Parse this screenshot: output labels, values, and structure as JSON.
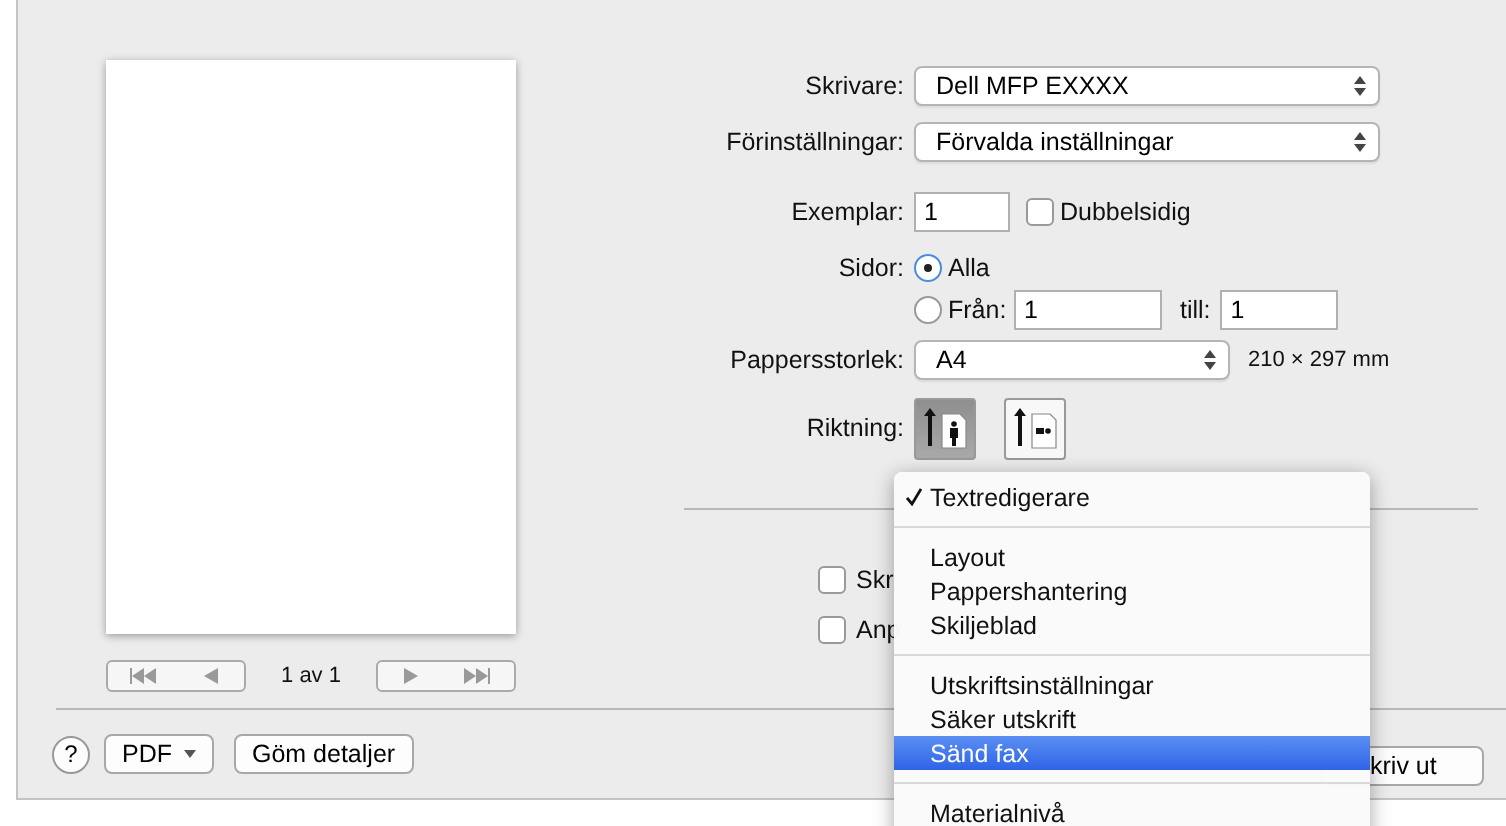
{
  "preview": {
    "page_counter": "1 av 1"
  },
  "printer": {
    "label": "Skrivare:",
    "value": "Dell MFP EXXXX"
  },
  "presets": {
    "label": "Förinställningar:",
    "value": "Förvalda inställningar"
  },
  "copies": {
    "label": "Exemplar:",
    "value": "1",
    "duplex": {
      "label": "Dubbelsidig",
      "checked": false
    }
  },
  "pages": {
    "label": "Sidor:",
    "options": [
      {
        "label": "Alla",
        "selected": true
      },
      {
        "label": "Från:",
        "selected": false
      }
    ],
    "from": "1",
    "to_label": "till:",
    "to": "1"
  },
  "paper_size": {
    "label": "Pappersstorlek:",
    "value": "A4",
    "dimensions": "210 × 297 mm"
  },
  "orientation": {
    "label": "Riktning:",
    "options": [
      {
        "kind": "portrait",
        "selected": true
      },
      {
        "kind": "landscape",
        "selected": false
      }
    ]
  },
  "options": [
    {
      "label": "Skr",
      "checked": false
    },
    {
      "label": "Anp",
      "checked": false
    }
  ],
  "menu": {
    "groups": [
      [
        {
          "label": "Textredigerare",
          "checked": true,
          "selected": false
        }
      ],
      [
        {
          "label": "Layout",
          "checked": false,
          "selected": false
        },
        {
          "label": "Pappershantering",
          "checked": false,
          "selected": false
        },
        {
          "label": "Skiljeblad",
          "checked": false,
          "selected": false
        }
      ],
      [
        {
          "label": "Utskriftsinställningar",
          "checked": false,
          "selected": false
        },
        {
          "label": "Säker utskrift",
          "checked": false,
          "selected": false
        },
        {
          "label": "Sänd fax",
          "checked": false,
          "selected": true
        }
      ],
      [
        {
          "label": "Materialnivå",
          "checked": false,
          "selected": false
        }
      ]
    ]
  },
  "footer": {
    "help": "?",
    "pdf": "PDF",
    "hide_details": "Göm detaljer",
    "print": "kriv ut"
  }
}
